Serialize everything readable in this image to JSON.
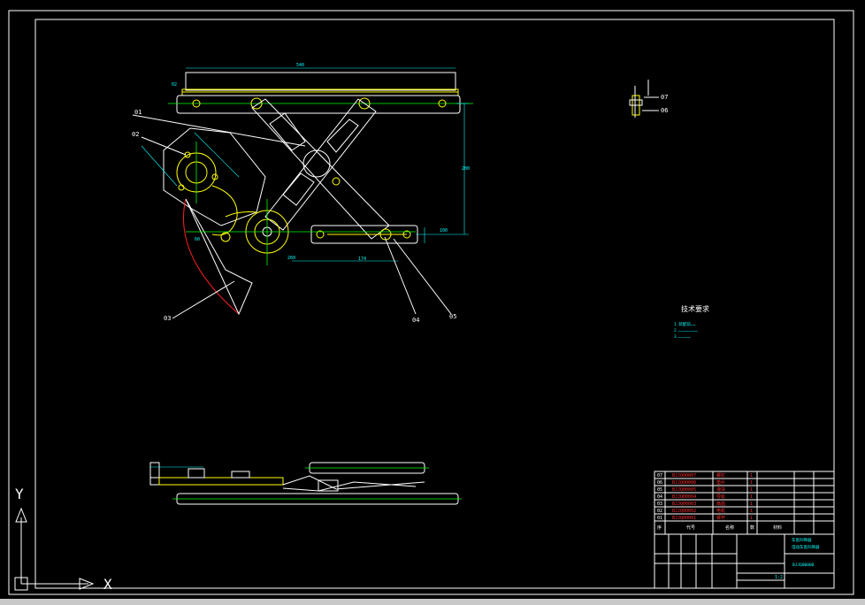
{
  "window": {
    "title": ""
  },
  "ucs": {
    "x_label": "X",
    "y_label": "Y"
  },
  "leaders": {
    "l01": "01",
    "l02": "02",
    "l03": "03",
    "l04": "04",
    "l05": "05",
    "l06": "06",
    "l07": "07"
  },
  "dims": {
    "top_width": "540",
    "left_02": "02",
    "right_height": "200",
    "guide_100": "100",
    "bottom_174": "174",
    "bottom_260": "260",
    "bottom_60": "60"
  },
  "tech_req": {
    "title": "技术要求",
    "lines": [
      "1.装配前……",
      "2.……………………",
      "3.……………"
    ]
  },
  "bom": {
    "rows": [
      {
        "no": "07",
        "code": "BJJQ00007",
        "name": "螺钉",
        "qty": "1"
      },
      {
        "no": "06",
        "code": "BJJQ00006",
        "name": "垫片",
        "qty": "1"
      },
      {
        "no": "05",
        "code": "BJJQ00005",
        "name": "滑块",
        "qty": "1"
      },
      {
        "no": "04",
        "code": "BJJQ00004",
        "name": "导轨",
        "qty": "1"
      },
      {
        "no": "03",
        "code": "BJJQ00003",
        "name": "扇齿",
        "qty": "1"
      },
      {
        "no": "02",
        "code": "BJJQ00002",
        "name": "电机",
        "qty": "1"
      },
      {
        "no": "01",
        "code": "BJJQ00001",
        "name": "臂杆",
        "qty": "1"
      }
    ],
    "header": {
      "no": "序",
      "code": "代号",
      "name": "名称",
      "qty": "数",
      "mat": "材料"
    },
    "title_main": "车窗升降器",
    "title_sub": "电动车窗升降器",
    "drawing_no": "BJJQ00000",
    "scale": "1:2"
  },
  "colors": {
    "background": "#000000",
    "frame": "#ffffff",
    "part": "#ffff00",
    "centerline": "#00ff00",
    "dimension": "#00ffff",
    "sector": "#ff2020",
    "bom_text": "#ff3030"
  }
}
